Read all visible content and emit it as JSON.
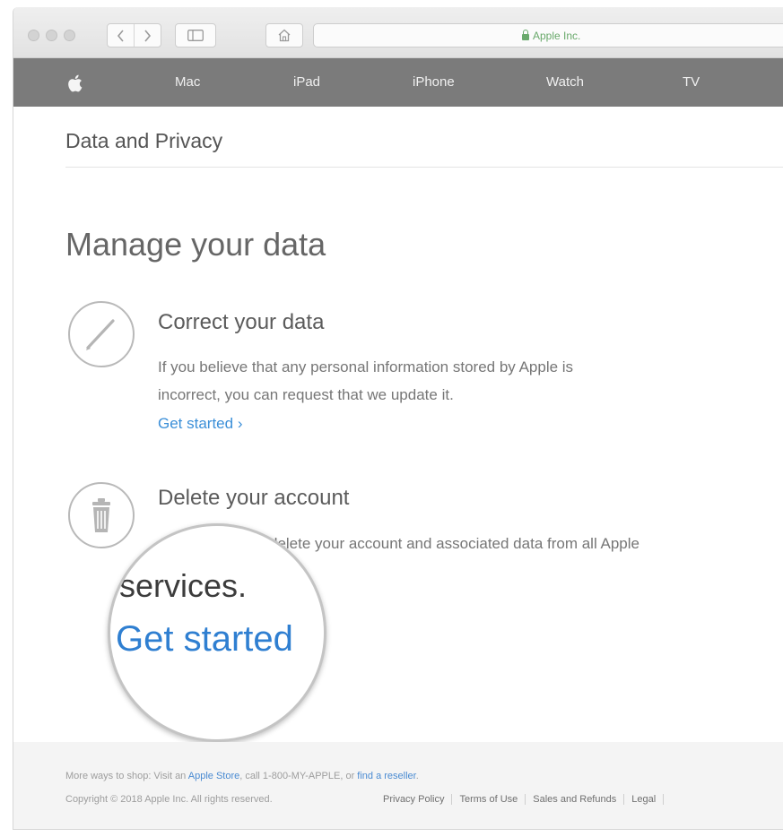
{
  "browser": {
    "address_text": "Apple Inc."
  },
  "globalnav": {
    "items": [
      "Mac",
      "iPad",
      "iPhone",
      "Watch",
      "TV"
    ]
  },
  "page": {
    "section_title": "Data and Privacy",
    "heading": "Manage your data",
    "correct": {
      "title": "Correct your data",
      "desc_line1": "If you believe that any personal information stored by Apple is",
      "desc_line2": "incorrect, you can request that we update it.",
      "link": "Get started ›"
    },
    "delete": {
      "title": "Delete your account",
      "desc_visible": "delete your account and associated data from all Apple"
    },
    "magnifier": {
      "services_text": "services.",
      "link_text": "Get started"
    }
  },
  "footer": {
    "shop_prefix": "More ways to shop: Visit an",
    "apple_store": "Apple Store",
    "shop_middle": ", call 1-800-MY-APPLE, or",
    "find_reseller": "find a reseller",
    "shop_suffix": ".",
    "copyright": "Copyright © 2018 Apple Inc. All rights reserved.",
    "legal_links": [
      "Privacy Policy",
      "Terms of Use",
      "Sales and Refunds",
      "Legal"
    ]
  }
}
